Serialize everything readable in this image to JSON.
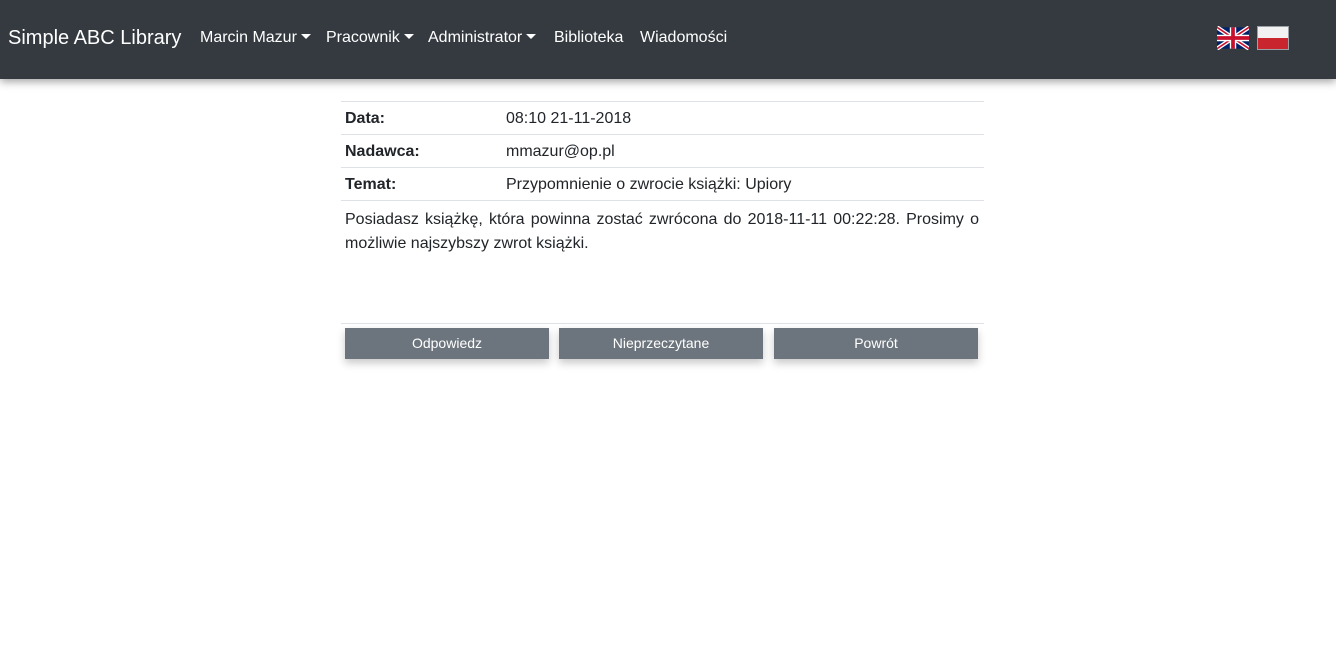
{
  "navbar": {
    "brand": "Simple ABC Library",
    "items": [
      {
        "label": "Marcin Mazur",
        "dropdown": true
      },
      {
        "label": "Pracownik",
        "dropdown": true
      },
      {
        "label": "Administrator",
        "dropdown": true
      },
      {
        "label": "Biblioteka",
        "dropdown": false
      },
      {
        "label": "Wiadomości",
        "dropdown": false
      }
    ],
    "languages": [
      {
        "icon": "uk-flag-icon",
        "code": "en"
      },
      {
        "icon": "poland-flag-icon",
        "code": "pl"
      }
    ],
    "background": "#343a40"
  },
  "message": {
    "fields": [
      {
        "label": "Data:",
        "value": "08:10 21-11-2018"
      },
      {
        "label": "Nadawca:",
        "value": "mmazur@op.pl"
      },
      {
        "label": "Temat:",
        "value": "Przypomnienie o zwrocie książki: Upiory"
      }
    ],
    "body": "Posiadasz książkę, która powinna zostać zwrócona do 2018-11-11 00:22:28. Prosimy o możliwie najszybszy zwrot książki."
  },
  "actions": {
    "reply_label": "Odpowiedz",
    "unread_label": "Nieprzeczytane",
    "back_label": "Powrót",
    "button_color": "#6c757d"
  }
}
